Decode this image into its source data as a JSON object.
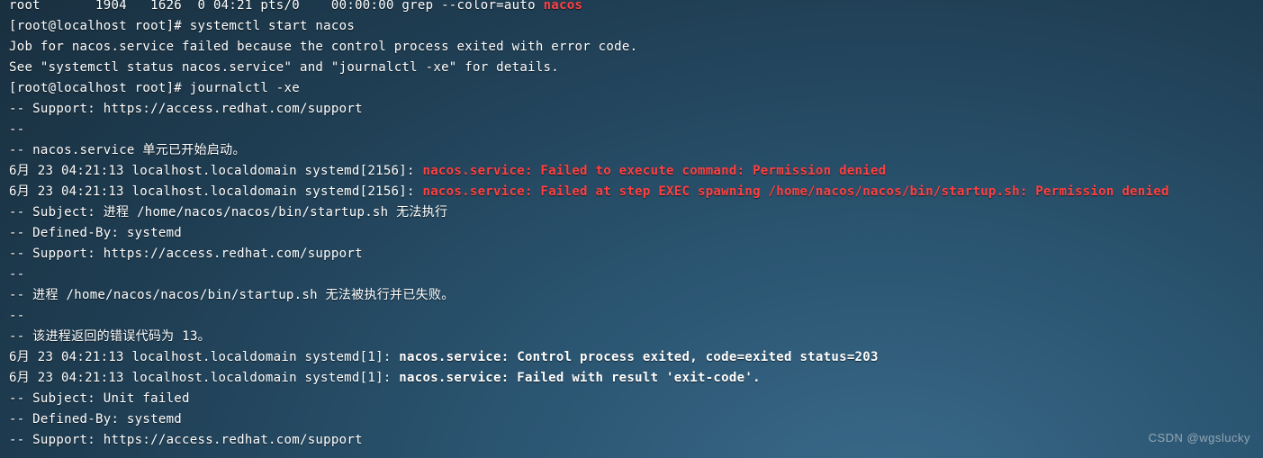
{
  "colors": {
    "error": "#ff4040",
    "bold": "#ffffff"
  },
  "watermark": "CSDN @wgslucky",
  "lines": [
    {
      "segments": [
        {
          "t": "root       1904   1626  0 04:21 pts/0    00:00:00 grep --color=auto "
        },
        {
          "t": "nacos",
          "cls": "red"
        }
      ]
    },
    {
      "segments": [
        {
          "t": "[root@localhost root]# systemctl start nacos"
        }
      ]
    },
    {
      "segments": [
        {
          "t": "Job for nacos.service failed because the control process exited with error code."
        }
      ]
    },
    {
      "segments": [
        {
          "t": "See \"systemctl status nacos.service\" and \"journalctl -xe\" for details."
        }
      ]
    },
    {
      "segments": [
        {
          "t": "[root@localhost root]# journalctl -xe"
        }
      ]
    },
    {
      "segments": [
        {
          "t": "-- Support: https://access.redhat.com/support"
        }
      ]
    },
    {
      "segments": [
        {
          "t": "--"
        }
      ]
    },
    {
      "segments": [
        {
          "t": "-- nacos.service 单元已开始启动。"
        }
      ]
    },
    {
      "segments": [
        {
          "t": "6月 23 04:21:13 localhost.localdomain systemd[2156]: "
        },
        {
          "t": "nacos.service: Failed to execute command: Permission denied",
          "cls": "red"
        }
      ]
    },
    {
      "segments": [
        {
          "t": "6月 23 04:21:13 localhost.localdomain systemd[2156]: "
        },
        {
          "t": "nacos.service: Failed at step EXEC spawning /home/nacos/nacos/bin/startup.sh: Permission denied",
          "cls": "red"
        }
      ]
    },
    {
      "segments": [
        {
          "t": "-- Subject: 进程 /home/nacos/nacos/bin/startup.sh 无法执行"
        }
      ]
    },
    {
      "segments": [
        {
          "t": "-- Defined-By: systemd"
        }
      ]
    },
    {
      "segments": [
        {
          "t": "-- Support: https://access.redhat.com/support"
        }
      ]
    },
    {
      "segments": [
        {
          "t": "--"
        }
      ]
    },
    {
      "segments": [
        {
          "t": "-- 进程 /home/nacos/nacos/bin/startup.sh 无法被执行并已失败。"
        }
      ]
    },
    {
      "segments": [
        {
          "t": "--"
        }
      ]
    },
    {
      "segments": [
        {
          "t": "-- 该进程返回的错误代码为 13。"
        }
      ]
    },
    {
      "segments": [
        {
          "t": "6月 23 04:21:13 localhost.localdomain systemd[1]: "
        },
        {
          "t": "nacos.service: Control process exited, code=exited status=203",
          "cls": "bold"
        }
      ]
    },
    {
      "segments": [
        {
          "t": "6月 23 04:21:13 localhost.localdomain systemd[1]: "
        },
        {
          "t": "nacos.service: Failed with result 'exit-code'.",
          "cls": "bold"
        }
      ]
    },
    {
      "segments": [
        {
          "t": "-- Subject: Unit failed"
        }
      ]
    },
    {
      "segments": [
        {
          "t": "-- Defined-By: systemd"
        }
      ]
    },
    {
      "segments": [
        {
          "t": "-- Support: https://access.redhat.com/support"
        }
      ]
    }
  ]
}
